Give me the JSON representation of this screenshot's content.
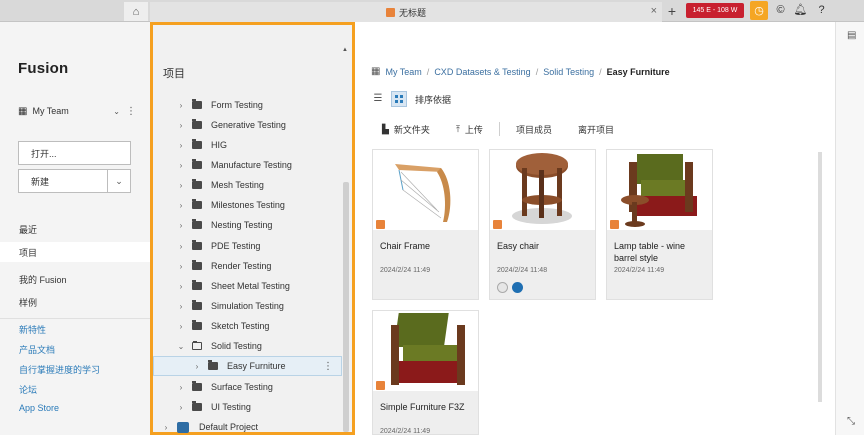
{
  "topbar": {
    "home_icon": "home-icon",
    "doc_tab_title": "无标题",
    "close_glyph": "×",
    "plus_glyph": "+",
    "status_badge": "145 E - 108 W",
    "accent_orange": "#f5a623",
    "badge_red": "#c8202f"
  },
  "leftnav": {
    "brand": "Fusion",
    "team_name": "My Team",
    "open_label": "打开...",
    "new_label": "新建",
    "nav_items": [
      "最近",
      "项目",
      "我的 Fusion",
      "样例"
    ],
    "links": [
      "新特性",
      "产品文档",
      "自行掌握进度的学习",
      "论坛",
      "App Store"
    ]
  },
  "tree": {
    "heading": "项目",
    "items": [
      {
        "label": "Form Testing"
      },
      {
        "label": "Generative Testing"
      },
      {
        "label": "HIG"
      },
      {
        "label": "Manufacture Testing"
      },
      {
        "label": "Mesh Testing"
      },
      {
        "label": "Milestones Testing"
      },
      {
        "label": "Nesting Testing"
      },
      {
        "label": "PDE Testing"
      },
      {
        "label": "Render Testing"
      },
      {
        "label": "Sheet Metal Testing"
      },
      {
        "label": "Simulation Testing"
      },
      {
        "label": "Sketch Testing"
      },
      {
        "label": "Solid Testing"
      },
      {
        "label": "Easy Furniture"
      },
      {
        "label": "Surface Testing"
      },
      {
        "label": "UI Testing"
      },
      {
        "label": "Default Project"
      }
    ],
    "highlight_color": "#f5a020"
  },
  "main": {
    "breadcrumb": [
      "My Team",
      "CXD Datasets & Testing",
      "Solid Testing",
      "Easy Furniture"
    ],
    "sort_label": "排序依据",
    "actions": {
      "new_folder": "新文件夹",
      "upload": "上传",
      "members": "项目成员",
      "leave": "离开项目"
    },
    "cards": [
      {
        "title": "Chair Frame",
        "date": "2024/2/24 11:49"
      },
      {
        "title": "Easy chair",
        "date": "2024/2/24 11:48"
      },
      {
        "title": "Lamp table - wine barrel style",
        "date": "2024/2/24 11:49"
      },
      {
        "title": "Simple Furniture F3Z",
        "date": "2024/2/24 11:49"
      }
    ]
  }
}
